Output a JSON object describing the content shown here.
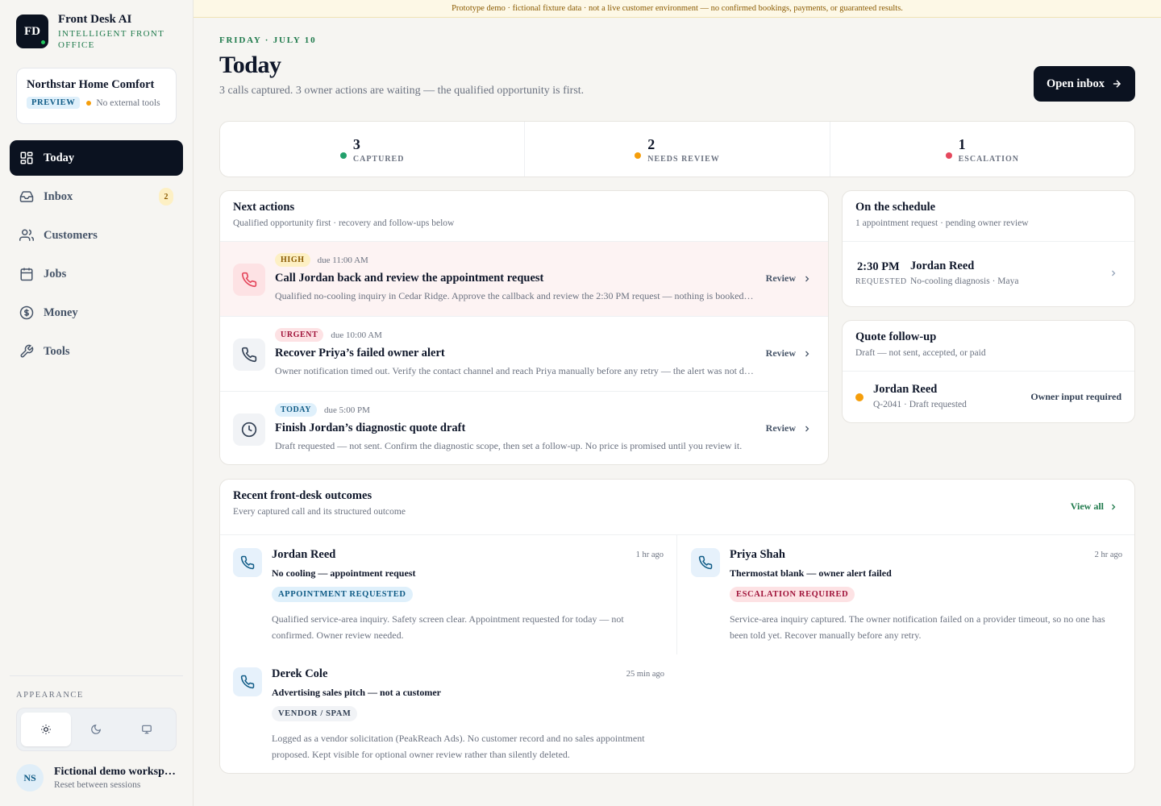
{
  "brand": {
    "logo_text": "FD",
    "name": "Front Desk AI",
    "subtitle": "INTELLIGENT FRONT OFFICE"
  },
  "org": {
    "name": "Northstar Home Comfort",
    "badge": "PREVIEW",
    "status": "No external tools"
  },
  "nav": [
    {
      "label": "Today",
      "icon": "grid-icon",
      "active": true
    },
    {
      "label": "Inbox",
      "icon": "inbox-icon",
      "badge": "2"
    },
    {
      "label": "Customers",
      "icon": "users-icon"
    },
    {
      "label": "Jobs",
      "icon": "calendar-icon"
    },
    {
      "label": "Money",
      "icon": "dollar-icon"
    },
    {
      "label": "Tools",
      "icon": "wrench-icon"
    }
  ],
  "appearance": {
    "label": "APPEARANCE",
    "options": [
      "light",
      "dark",
      "system"
    ],
    "selected": "light"
  },
  "user": {
    "initials": "NS",
    "name": "Fictional demo workspace",
    "subtitle": "Reset between sessions"
  },
  "banner": "Prototype demo · fictional fixture data · not a live customer environment — no confirmed bookings, payments, or guaranteed results.",
  "header": {
    "date": "FRIDAY · JULY 10",
    "title": "Today",
    "subtitle": "3 calls captured. 3 owner actions are waiting — the qualified opportunity is first.",
    "inbox_button": "Open inbox"
  },
  "stats": [
    {
      "value": "3",
      "label": "CAPTURED",
      "color": "#22a06b"
    },
    {
      "value": "2",
      "label": "NEEDS REVIEW",
      "color": "#f59e0b"
    },
    {
      "value": "1",
      "label": "ESCALATION",
      "color": "#e5485d"
    }
  ],
  "next_actions": {
    "title": "Next actions",
    "subtitle": "Qualified opportunity first · recovery and follow-ups below",
    "review_label": "Review",
    "items": [
      {
        "priority": "HIGH",
        "due": "due 11:00 AM",
        "title": "Call Jordan back and review the appointment request",
        "desc": "Qualified no-cooling inquiry in Cedar Ridge. Approve the callback and review the 2:30 PM request — nothing is booked yet.",
        "icon": "phone-icon"
      },
      {
        "priority": "URGENT",
        "due": "due 10:00 AM",
        "title": "Recover Priya’s failed owner alert",
        "desc": "Owner notification timed out. Verify the contact channel and reach Priya manually before any retry — the alert was not delivered.",
        "icon": "phone-icon"
      },
      {
        "priority": "TODAY",
        "due": "due 5:00 PM",
        "title": "Finish Jordan’s diagnostic quote draft",
        "desc": "Draft requested — not sent. Confirm the diagnostic scope, then set a follow-up. No price is promised until you review it.",
        "icon": "clock-icon"
      }
    ]
  },
  "schedule": {
    "title": "On the schedule",
    "subtitle": "1 appointment request · pending owner review",
    "item": {
      "time": "2:30 PM",
      "status": "REQUESTED",
      "name": "Jordan Reed",
      "detail": "No-cooling diagnosis · Maya"
    }
  },
  "quote": {
    "title": "Quote follow-up",
    "subtitle": "Draft — not sent, accepted, or paid",
    "item": {
      "name": "Jordan Reed",
      "detail": "Q-2041 · Draft requested",
      "status": "Owner input required"
    }
  },
  "outcomes": {
    "title": "Recent front-desk outcomes",
    "subtitle": "Every captured call and its structured outcome",
    "view_all": "View all",
    "items": [
      {
        "name": "Jordan Reed",
        "time": "1 hr ago",
        "summary": "No cooling — appointment request",
        "badge": "APPOINTMENT REQUESTED",
        "desc": "Qualified service-area inquiry. Safety screen clear. Appointment requested for today — not confirmed. Owner review needed."
      },
      {
        "name": "Priya Shah",
        "time": "2 hr ago",
        "summary": "Thermostat blank — owner alert failed",
        "badge": "ESCALATION REQUIRED",
        "desc": "Service-area inquiry captured. The owner notification failed on a provider timeout, so no one has been told yet. Recover manually before any retry."
      },
      {
        "name": "Derek Cole",
        "time": "25 min ago",
        "summary": "Advertising sales pitch — not a customer",
        "badge": "VENDOR / SPAM",
        "desc": "Logged as a vendor solicitation (PeakReach Ads). No customer record and no sales appointment proposed. Kept visible for optional owner review rather than silently deleted."
      }
    ]
  }
}
